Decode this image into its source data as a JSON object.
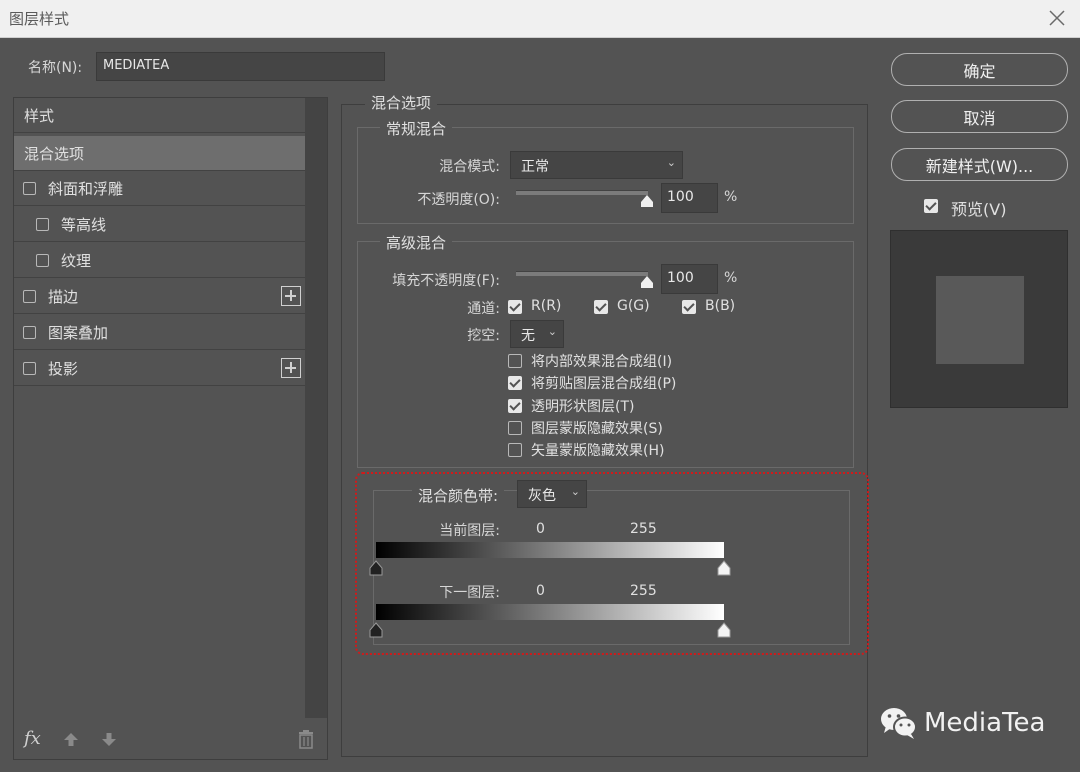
{
  "window": {
    "title": "图层样式"
  },
  "name_field": {
    "label": "名称(N):",
    "value": "MEDIATEA"
  },
  "left_panel": {
    "items": [
      {
        "label": "样式"
      },
      {
        "label": "混合选项"
      },
      {
        "label": "斜面和浮雕"
      },
      {
        "label": "等高线"
      },
      {
        "label": "纹理"
      },
      {
        "label": "描边"
      },
      {
        "label": "图案叠加"
      },
      {
        "label": "投影"
      }
    ],
    "fx_label": "fx"
  },
  "blend_options": {
    "section_title": "混合选项",
    "general": {
      "title": "常规混合",
      "mode_label": "混合模式:",
      "mode_value": "正常",
      "opacity_label": "不透明度(O):",
      "opacity_value": "100",
      "opacity_unit": "%",
      "opacity_level": 1.0
    },
    "advanced": {
      "title": "高级混合",
      "fill_label": "填充不透明度(F):",
      "fill_value": "100",
      "fill_unit": "%",
      "fill_level": 1.0,
      "channels_label": "通道:",
      "channels": [
        {
          "label": "R(R)",
          "checked": true
        },
        {
          "label": "G(G)",
          "checked": true
        },
        {
          "label": "B(B)",
          "checked": true
        }
      ],
      "knockout_label": "挖空:",
      "knockout_value": "无",
      "options": [
        {
          "label": "将内部效果混合成组(I)",
          "checked": false
        },
        {
          "label": "将剪贴图层混合成组(P)",
          "checked": true
        },
        {
          "label": "透明形状图层(T)",
          "checked": true
        },
        {
          "label": "图层蒙版隐藏效果(S)",
          "checked": false
        },
        {
          "label": "矢量蒙版隐藏效果(H)",
          "checked": false
        }
      ]
    },
    "blend_if": {
      "label": "混合颜色带:",
      "value": "灰色",
      "this_layer": {
        "label": "当前图层:",
        "low": "0",
        "high": "255"
      },
      "underlying_layer": {
        "label": "下一图层:",
        "low": "0",
        "high": "255"
      }
    }
  },
  "buttons": {
    "ok": "确定",
    "cancel": "取消",
    "new_style": "新建样式(W)...",
    "preview_label": "预览(V)",
    "preview_checked": true
  },
  "watermark": {
    "text": "MediaTea"
  }
}
